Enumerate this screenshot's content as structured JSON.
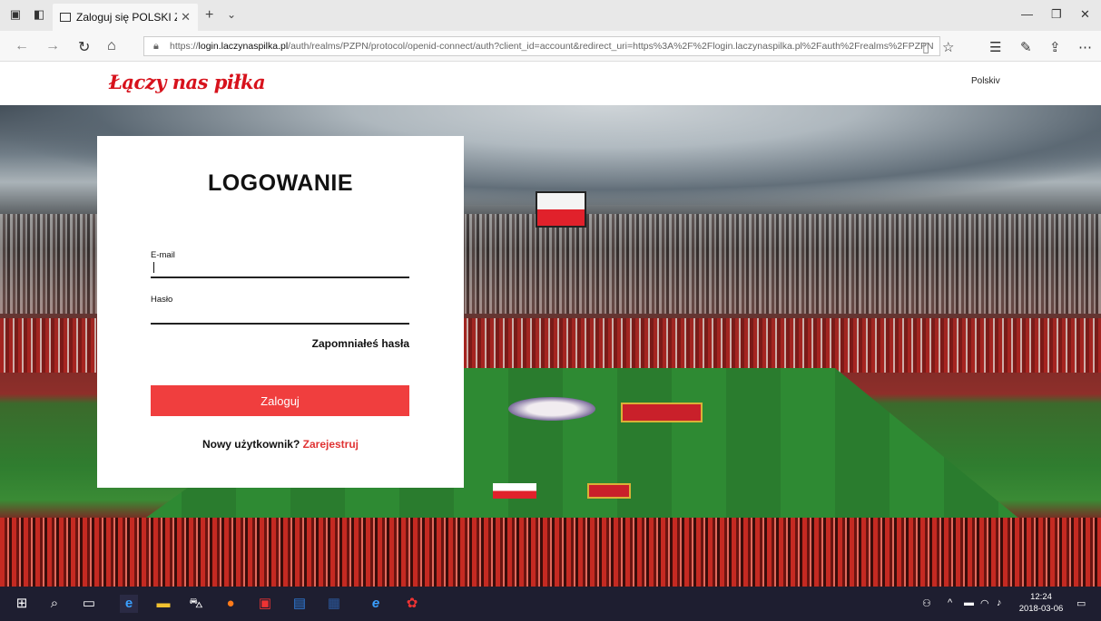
{
  "browser": {
    "tab_title": "Zaloguj się POLSKI ZWIĄ",
    "url_prefix": "https://",
    "url_host": "login.laczynaspilka.pl",
    "url_path": "/auth/realms/PZPN/protocol/openid-connect/auth?client_id=account&redirect_uri=https%3A%2F%2Flogin.laczynaspilka.pl%2Fauth%2Frealms%2FPZPN"
  },
  "site": {
    "logo": "Łączy nas piłka",
    "language": "Polski"
  },
  "login": {
    "title": "LOGOWANIE",
    "email_label": "E-mail",
    "password_label": "Hasło",
    "forgot_link": "Zapomniałeś hasła",
    "submit_label": "Zaloguj",
    "new_user_text": "Nowy użytkownik?",
    "register_link": "Zarejestruj"
  },
  "taskbar": {
    "time": "12:24",
    "date": "2018-03-06"
  },
  "colors": {
    "brand_red": "#d7121c",
    "button_red": "#f03e3e",
    "link_red": "#e03333",
    "taskbar": "#1e1e30"
  }
}
